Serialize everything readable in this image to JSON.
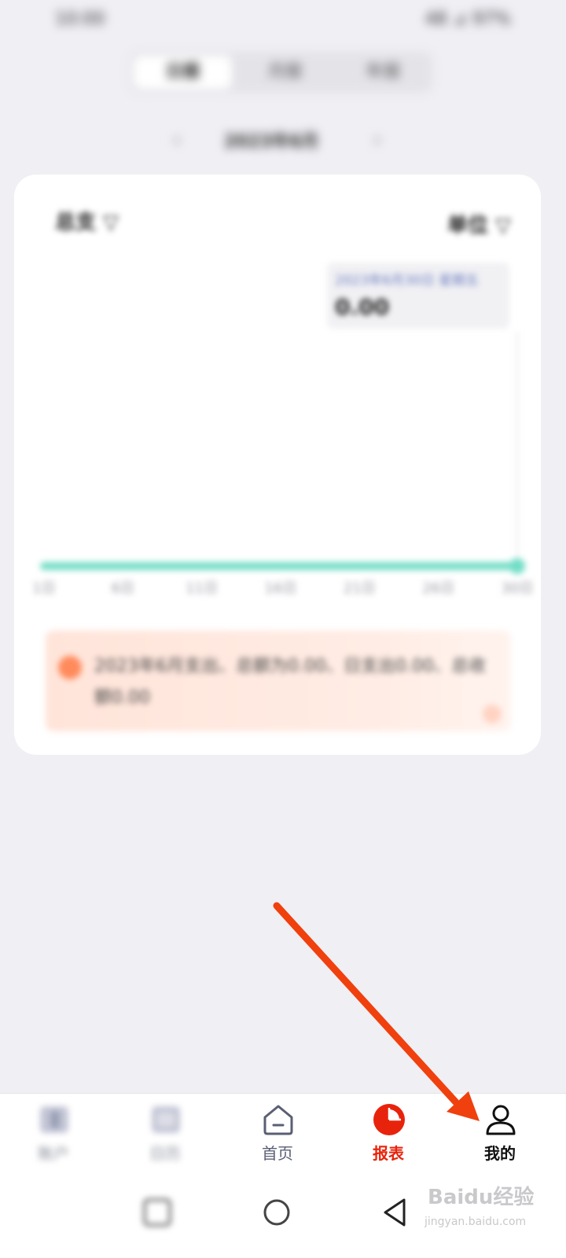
{
  "status_bar": {
    "time": "10:00",
    "indicators": "48 ⊿ 97%"
  },
  "period_tabs": {
    "items": [
      "日报",
      "月报",
      "年报"
    ],
    "selected": 0
  },
  "date_nav": {
    "label": "2023年6月",
    "prev_icon": "chevron-left-icon",
    "next_icon": "chevron-right-icon"
  },
  "card": {
    "filter_left": "总支 ▽",
    "filter_right": "单位 ▽",
    "tooltip": {
      "date": "2023年6月30日 星期五",
      "value": "0.00"
    },
    "banner": {
      "text": "2023年6月支出、总额为0.00、日支出0.00、总收额0.00"
    }
  },
  "chart_data": {
    "type": "line",
    "x": [
      "1日",
      "6日",
      "11日",
      "16日",
      "21日",
      "26日",
      "30日"
    ],
    "series": [
      {
        "values": [
          0,
          0,
          0,
          0,
          0,
          0,
          0
        ]
      }
    ],
    "ylim": [
      0,
      1
    ],
    "color": "#72ddc6",
    "grid": false
  },
  "tabbar": {
    "items": [
      {
        "label": "账户",
        "icon": "wallet-icon",
        "active": false
      },
      {
        "label": "日历",
        "icon": "calendar-icon",
        "active": false
      },
      {
        "label": "首页",
        "icon": "home-icon",
        "active": false
      },
      {
        "label": "报表",
        "icon": "pie-chart-icon",
        "active": true
      },
      {
        "label": "我的",
        "icon": "person-icon",
        "active": false
      }
    ],
    "active_color": "#e8230c"
  },
  "system_nav": {
    "buttons": [
      "recents-icon",
      "home-circle-icon",
      "back-triangle-icon"
    ]
  },
  "watermark": {
    "main": "Baidu经验",
    "sub": "jingyan.baidu.com"
  },
  "annotation": {
    "color": "#f0400e"
  }
}
